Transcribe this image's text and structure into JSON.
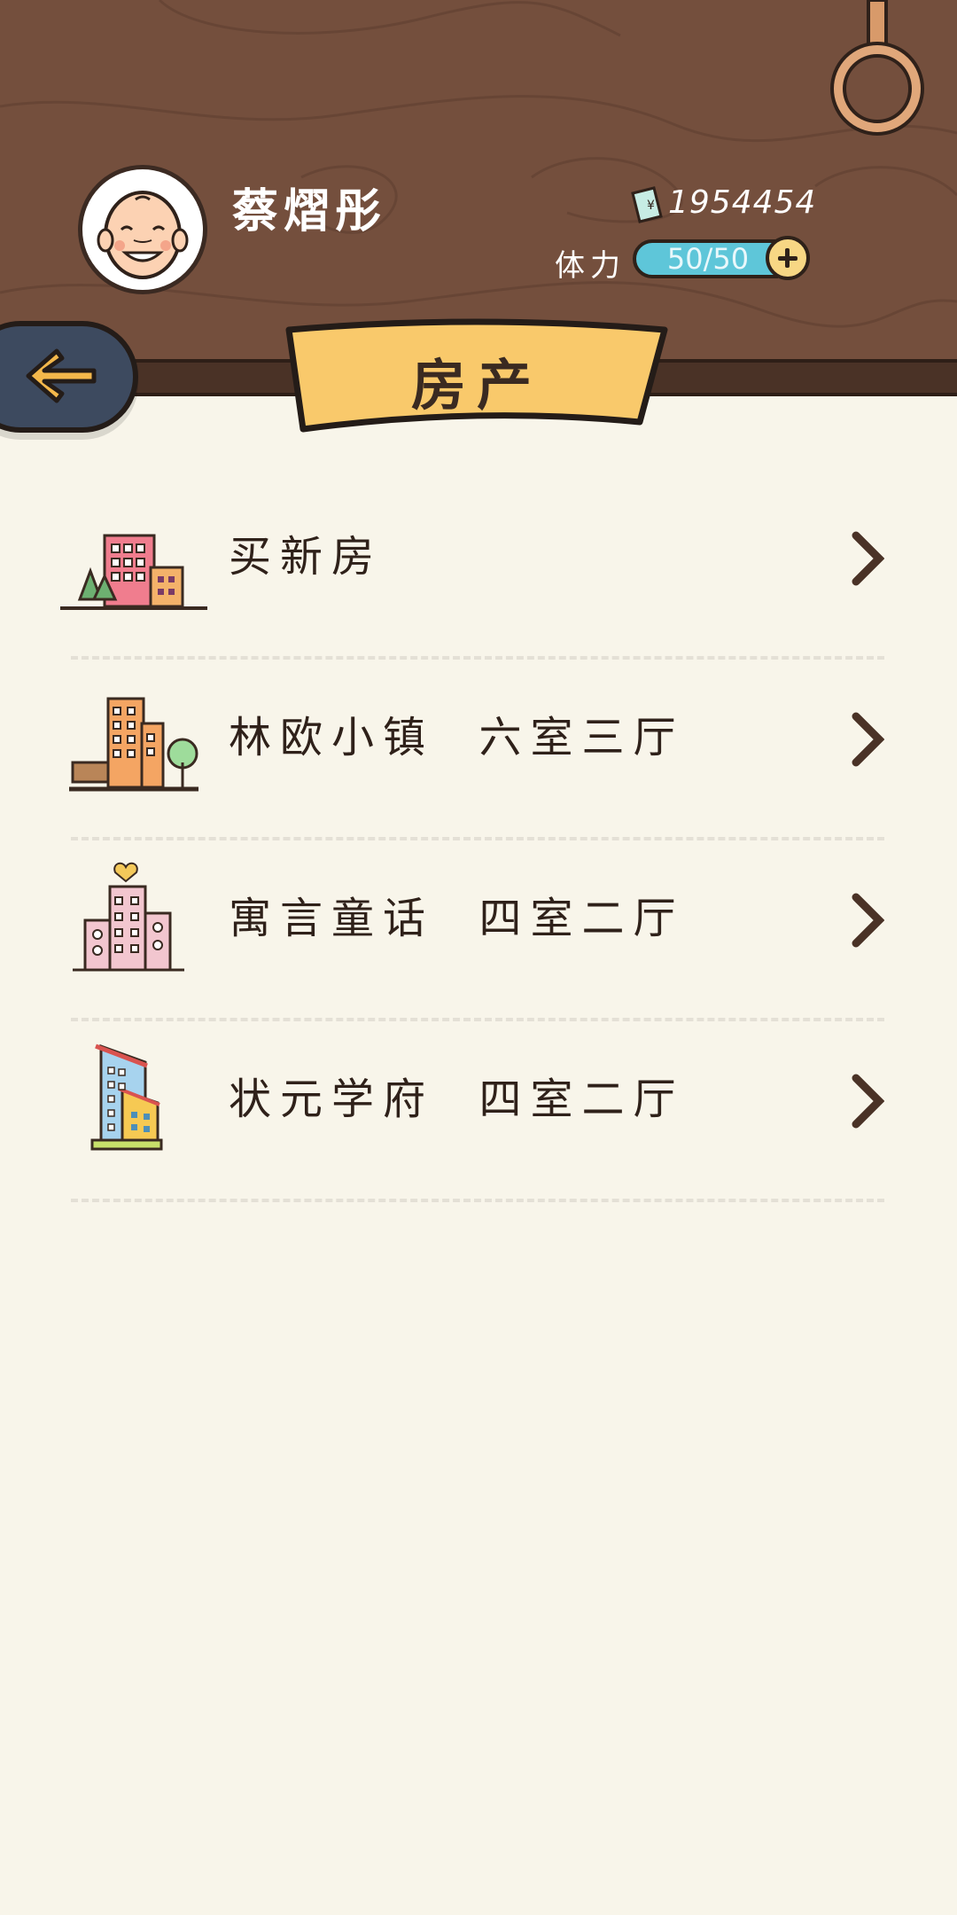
{
  "player": {
    "name": "蔡熠彤",
    "money": "1954454",
    "stamina_label": "体力",
    "stamina_value": "50/50"
  },
  "page": {
    "title": "房产"
  },
  "menu": {
    "items": [
      {
        "label": "买新房",
        "icon": "buildings-with-trees-icon"
      },
      {
        "label": "林欧小镇  六室三厅",
        "icon": "orange-building-with-bench-icon"
      },
      {
        "label": "寓言童话  四室二厅",
        "icon": "pink-building-with-heart-icon"
      },
      {
        "label": "状元学府  四室二厅",
        "icon": "blue-tower-building-icon"
      }
    ]
  },
  "colors": {
    "header_wood": "#744f3d",
    "ribbon": "#f9c96b",
    "stamina_bar": "#5ec6d9",
    "background": "#f8f5ea",
    "back_button": "#3d4a5f"
  }
}
